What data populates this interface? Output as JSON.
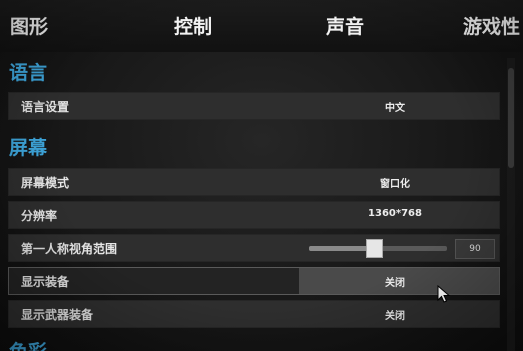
{
  "tabs": [
    {
      "label": "图形"
    },
    {
      "label": "控制"
    },
    {
      "label": "声音"
    },
    {
      "label": "游戏性"
    }
  ],
  "sections": {
    "language": {
      "title": "语言",
      "rows": [
        {
          "label": "语言设置",
          "value": "中文"
        }
      ]
    },
    "screen": {
      "title": "屏幕",
      "rows": [
        {
          "label": "屏幕模式",
          "value": "窗口化"
        },
        {
          "label": "分辨率",
          "value": "1360*768"
        },
        {
          "label": "第一人称视角范围",
          "slider_value": "90",
          "slider_fraction": 0.47
        },
        {
          "label": "显示装备",
          "value": "关闭"
        },
        {
          "label": "显示武器装备",
          "value": "关闭"
        }
      ]
    },
    "next_section": {
      "title": "色彩"
    }
  },
  "icons": {
    "cursor": "mouse-pointer-icon"
  },
  "colors": {
    "section_title": "#3ea6dc",
    "row_background": "#2e2e2e",
    "hover_highlight": "#4a4a4a"
  }
}
